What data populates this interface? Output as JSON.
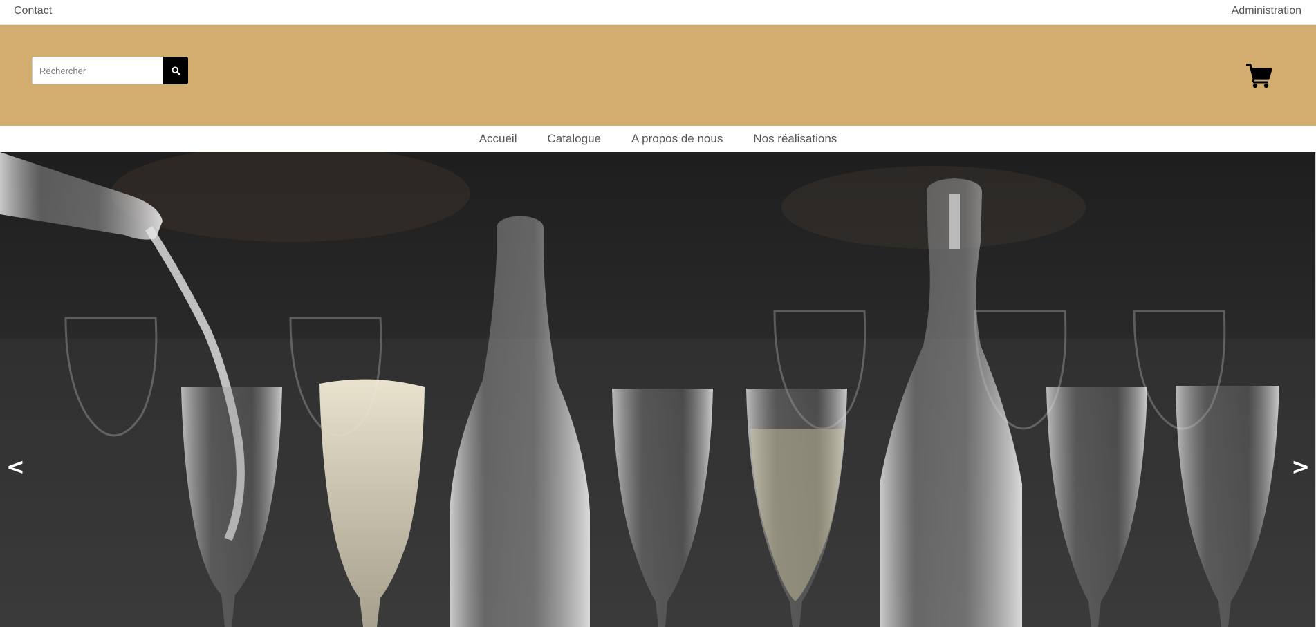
{
  "topbar": {
    "contact_label": "Contact",
    "admin_label": "Administration"
  },
  "header": {
    "banner_color": "#d3ad6f",
    "search": {
      "placeholder": "Rechercher",
      "value": "",
      "button_icon": "search-icon"
    },
    "cart_icon": "shopping-cart-icon"
  },
  "nav": {
    "items": [
      {
        "label": "Accueil"
      },
      {
        "label": "Catalogue"
      },
      {
        "label": "A propos de nous"
      },
      {
        "label": "Nos réalisations"
      }
    ]
  },
  "carousel": {
    "image_subject": "champagne-glasses-and-bottles",
    "prev_label": "<",
    "next_label": ">"
  }
}
